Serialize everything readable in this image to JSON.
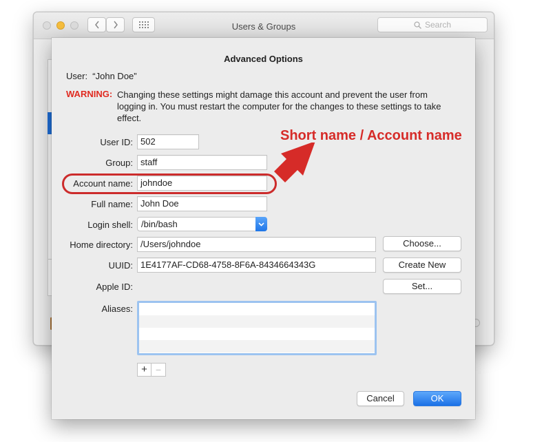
{
  "window": {
    "title": "Users & Groups",
    "search_placeholder": "Search"
  },
  "sheet": {
    "title": "Advanced Options",
    "user_label": "User:",
    "user_value": "“John Doe”",
    "warning_label": "WARNING:",
    "warning_text": "Changing these settings might damage this account and prevent the user from logging in. You must restart the computer for the changes to these settings to take effect.",
    "fields": {
      "user_id": {
        "label": "User ID:",
        "value": "502"
      },
      "group": {
        "label": "Group:",
        "value": "staff"
      },
      "account_name": {
        "label": "Account name:",
        "value": "johndoe"
      },
      "full_name": {
        "label": "Full name:",
        "value": "John Doe"
      },
      "login_shell": {
        "label": "Login shell:",
        "value": "/bin/bash"
      },
      "home_directory": {
        "label": "Home directory:",
        "value": "/Users/johndoe"
      },
      "uuid": {
        "label": "UUID:",
        "value": "1E4177AF-CD68-4758-8F6A-8434664343G"
      },
      "apple_id": {
        "label": "Apple ID:"
      },
      "aliases": {
        "label": "Aliases:"
      }
    },
    "buttons": {
      "choose": "Choose...",
      "create_new": "Create New",
      "set": "Set...",
      "plus": "+",
      "minus": "−",
      "cancel": "Cancel",
      "ok": "OK"
    }
  },
  "annotation": {
    "text": "Short name / Account name",
    "color": "#d62b28"
  },
  "colors": {
    "accent": "#1f76e8",
    "warning": "#e02a20"
  }
}
